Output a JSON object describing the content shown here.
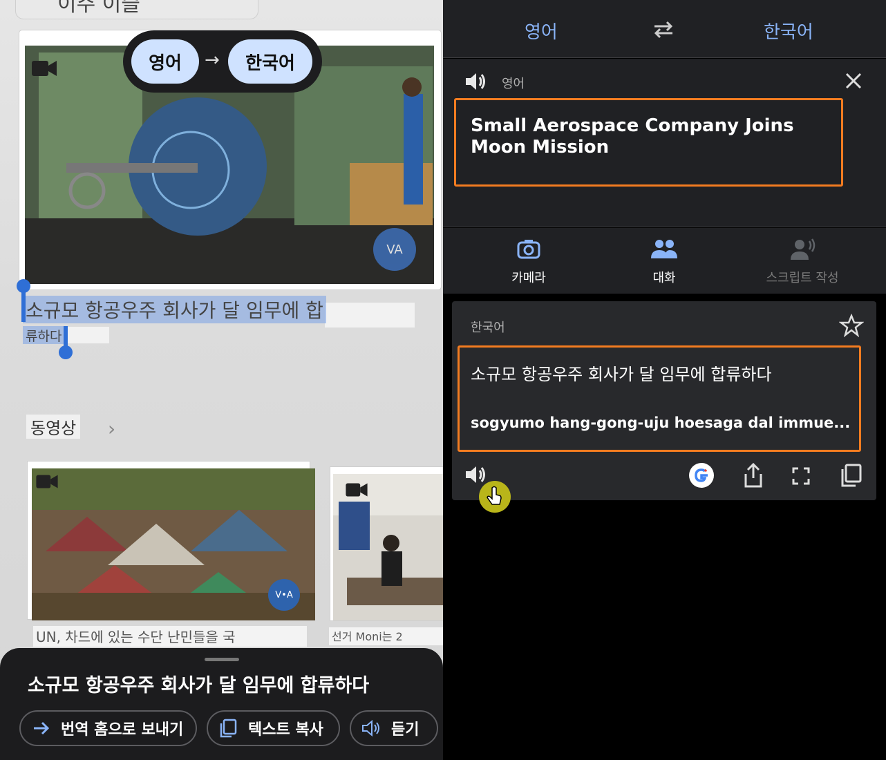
{
  "camera": {
    "top_fragment": "이주 이슬",
    "lang_pill": {
      "source": "영어",
      "target": "한국어"
    },
    "video_badge": "VA",
    "overlay_line1": "소규모 항공우주 회사가 달 임무에 합",
    "overlay_line2": "류하다",
    "section_label": "동영상",
    "thumb_badge": "V•A",
    "caption_left": "UN, 차드에 있는 수단 난민들을 국",
    "caption_right": "선거 Moni는 2",
    "sheet": {
      "title": "소규모 항공우주 회사가 달 임무에 합류하다",
      "send_home": "번역 홈으로 보내기",
      "copy_text": "텍스트 복사",
      "listen": "듣기"
    }
  },
  "translate": {
    "source_lang": "영어",
    "target_lang": "한국어",
    "source_label": "영어",
    "source_text": "Small Aerospace Company Joins Moon Mission",
    "modes": [
      {
        "label": "카메라",
        "icon": "camera-icon"
      },
      {
        "label": "대화",
        "icon": "conversation-icon"
      },
      {
        "label": "스크립트 작성",
        "icon": "transcribe-icon"
      }
    ],
    "result_label": "한국어",
    "result_text": "소규모 항공우주 회사가 달 임무에 합류하다",
    "romanization": "sogyumo hang-gong-uju hoesaga dal immue..."
  },
  "colors": {
    "accent_blue": "#8ab4f8",
    "highlight_orange": "#f47c20",
    "panel_dark": "#202124",
    "pill_blue": "#cfe2ff"
  }
}
